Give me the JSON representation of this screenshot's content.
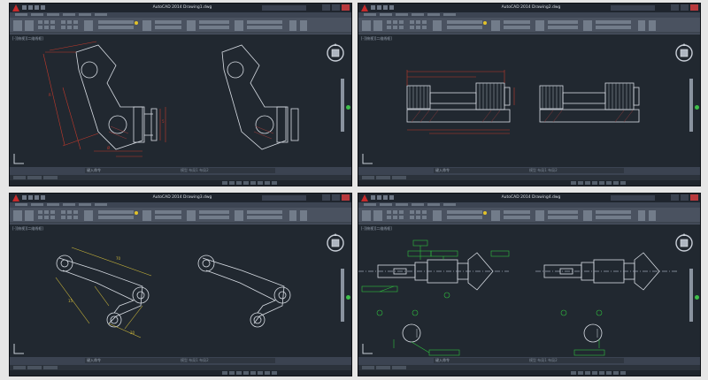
{
  "windows": [
    {
      "title": "AutoCAD 2014  Drawing1.dwg",
      "viewport_label": "[-][俯视][二维线框]",
      "command_line": "键入命令",
      "status_text": "模型  布局1  布局2",
      "drawing": "bracket"
    },
    {
      "title": "AutoCAD 2014  Drawing2.dwg",
      "viewport_label": "[-][俯视][二维线框]",
      "command_line": "键入命令",
      "status_text": "模型  布局1  布局2",
      "drawing": "rollers"
    },
    {
      "title": "AutoCAD 2014  Drawing3.dwg",
      "viewport_label": "[-][俯视][二维线框]",
      "command_line": "键入命令",
      "status_text": "模型  布局1  布局2",
      "drawing": "linkage"
    },
    {
      "title": "AutoCAD 2014  Drawing4.dwg",
      "viewport_label": "[-][俯视][二维线框]",
      "command_line": "键入命令",
      "status_text": "模型  布局1  布局2",
      "drawing": "shaft"
    }
  ],
  "colors": {
    "workspace_background": "#212830",
    "ribbon": "#4a5260",
    "titlebar": "#1f252e",
    "geometry": "#d8dde4",
    "dimension_red": "#c0392b",
    "dimension_yellow": "#c9b53a",
    "dimension_green": "#2fbf3f",
    "viewcube": "#c9cfd8",
    "nav_status": "#3fbf4a"
  },
  "icons": [
    "autocad-logo-icon",
    "viewcube-icon",
    "close-icon",
    "maximize-icon",
    "minimize-icon",
    "ucs-axis-icon"
  ]
}
